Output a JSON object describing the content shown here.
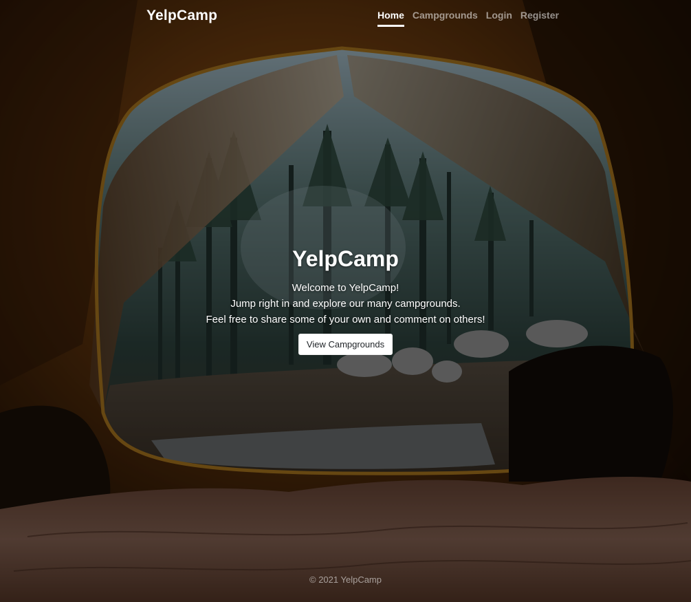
{
  "nav": {
    "brand": "YelpCamp",
    "links": [
      {
        "label": "Home",
        "active": true
      },
      {
        "label": "Campgrounds",
        "active": false
      },
      {
        "label": "Login",
        "active": false
      },
      {
        "label": "Register",
        "active": false
      }
    ]
  },
  "hero": {
    "title": "YelpCamp",
    "lines": [
      "Welcome to YelpCamp!",
      "Jump right in and explore our many campgrounds.",
      "Feel free to share some of your own and comment on others!"
    ],
    "button_label": "View Campgrounds"
  },
  "footer": {
    "text": "© 2021 YelpCamp"
  },
  "colors": {
    "tent": "#8a4f14",
    "tent_dark": "#2a1505",
    "forest": "#3e5a55",
    "sky": "#9fb8c4",
    "sleeping_bag": "#7a5a4a"
  }
}
